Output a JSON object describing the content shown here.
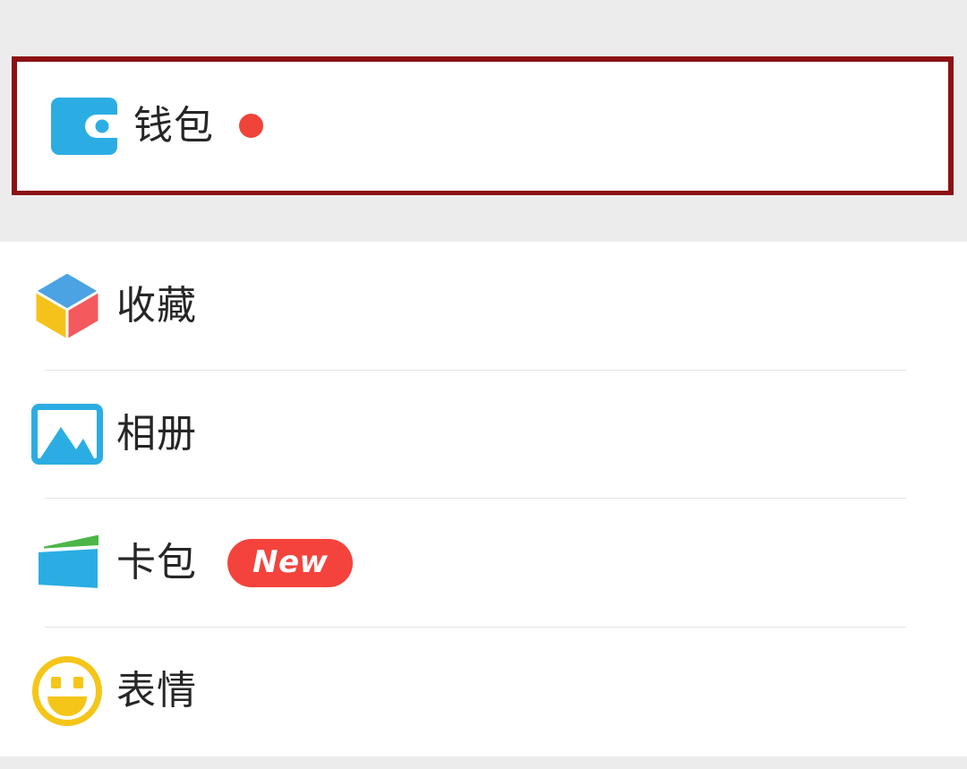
{
  "screen": {
    "app": "WeChat",
    "section": "me-menu",
    "background_color": "#ececec",
    "card_background_color": "#ffffff"
  },
  "highlight": {
    "border_color": "#8c1114",
    "border_width_px": 6,
    "target_row": "wallet"
  },
  "rows": [
    {
      "id": "wallet",
      "label": "钱包",
      "icon": "wallet-icon",
      "icon_color": "#2bade3",
      "badge_type": "dot",
      "badge_color": "#f0433a",
      "badge_text": "",
      "highlighted": true
    },
    {
      "id": "favorites",
      "label": "收藏",
      "icon": "favorites-cube-icon",
      "icon_color": "#4ba3e3",
      "badge_type": "none",
      "badge_text": "",
      "highlighted": false
    },
    {
      "id": "album",
      "label": "相册",
      "icon": "photo-album-icon",
      "icon_color": "#2bade3",
      "badge_type": "none",
      "badge_text": "",
      "highlighted": false
    },
    {
      "id": "cards",
      "label": "卡包",
      "icon": "card-package-icon",
      "icon_color": "#2bade3",
      "badge_type": "pill",
      "badge_color": "#f4433c",
      "badge_text": "New",
      "highlighted": false
    },
    {
      "id": "stickers",
      "label": "表情",
      "icon": "smiley-face-icon",
      "icon_color": "#f5c518",
      "badge_type": "none",
      "badge_text": "",
      "highlighted": false
    }
  ],
  "palette": {
    "blue": "#2bade3",
    "cube_top_blue": "#4ba3e3",
    "cube_left_yellow": "#f5c21b",
    "cube_right_red": "#f4595e",
    "card_green": "#4cb648",
    "smiley_yellow": "#f5c518",
    "badge_red": "#f4433c",
    "dot_red": "#f0433a",
    "text": "#262626",
    "divider": "#e3e3e3",
    "highlight_border": "#8c1114"
  }
}
